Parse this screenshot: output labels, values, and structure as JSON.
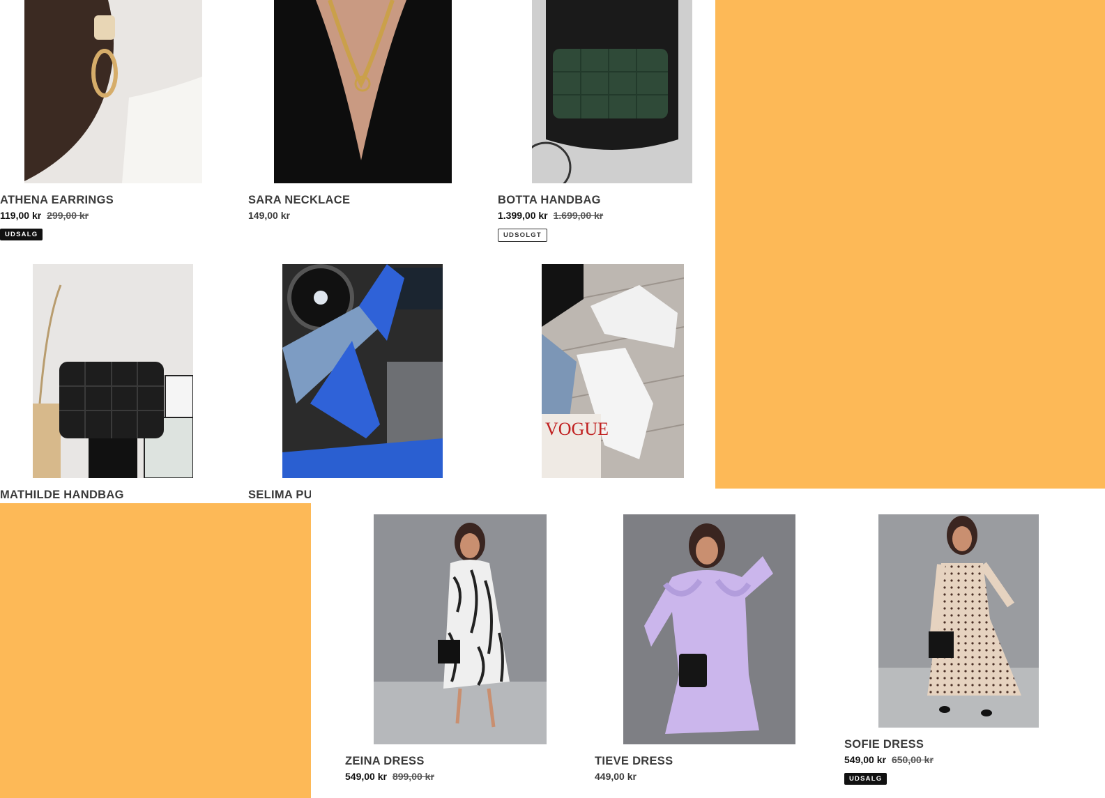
{
  "colors": {
    "accent": "#FDB957",
    "badge_sale": "#111111"
  },
  "products": [
    {
      "title": "ATHENA EARRINGS",
      "price": "119,00 kr",
      "compare_price": "299,00 kr",
      "badge": "UDSALG",
      "image": "earring-image"
    },
    {
      "title": "SARA NECKLACE",
      "price": "149,00 kr",
      "image": "necklace-image"
    },
    {
      "title": "BOTTA HANDBAG",
      "price": "1.399,00 kr",
      "compare_price": "1.699,00 kr",
      "badge": "UDSOLGT",
      "image": "green-handbag-image"
    },
    {
      "title": "MATHILDE HANDBAG",
      "image": "black-quilted-handbag-image"
    },
    {
      "title": "SELIMA PU",
      "image": "blue-pumps-image"
    },
    {
      "image": "white-boots-image"
    },
    {
      "title": "ZEINA DRESS",
      "price": "549,00 kr",
      "compare_price": "899,00 kr",
      "image": "zebra-dress-image"
    },
    {
      "title": "TIEVE DRESS",
      "price": "449,00 kr",
      "image": "lilac-dress-image"
    },
    {
      "title": "SOFIE DRESS",
      "price": "549,00 kr",
      "compare_price": "650,00 kr",
      "badge": "UDSALG",
      "image": "polka-dot-dress-image"
    }
  ]
}
